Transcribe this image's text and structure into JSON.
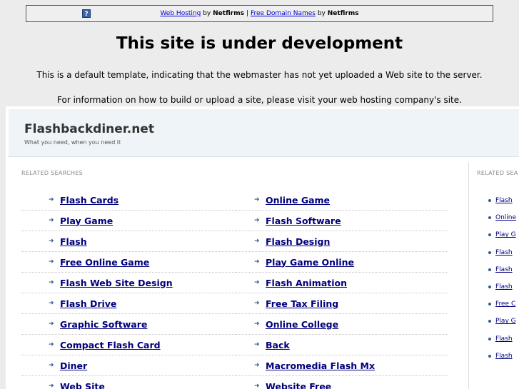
{
  "topbar": {
    "icon": "question-icon",
    "link1": "Web Hosting",
    "by1": "by",
    "brand1": "Netfirms",
    "sep": "|",
    "link2": "Free Domain Names",
    "by2": "by",
    "brand2": "Netfirms"
  },
  "title": "This site is under development",
  "info1": "This is a default template, indicating that the webmaster has not yet uploaded a Web site to the server.",
  "info2": "For information on how to build or upload a site, please visit your web hosting company's site.",
  "panel": {
    "site_name": "Flashbackdiner.net",
    "tagline": "What you need, when you need it",
    "related_label": "RELATED SEARCHES",
    "related_label_side": "RELATED SEA",
    "left_items": [
      "Flash Cards",
      "Play Game",
      "Flash",
      "Free Online Game",
      "Flash Web Site Design",
      "Flash Drive",
      "Graphic Software",
      "Compact Flash Card",
      "Diner",
      "Web Site"
    ],
    "right_items": [
      "Online Game",
      "Flash Software",
      "Flash Design",
      "Play Game Online",
      "Flash Animation",
      "Free Tax Filing",
      "Online College",
      "Back",
      "Macromedia Flash Mx",
      "Website Free"
    ],
    "side_items": [
      "Flash",
      "Online",
      "Play G",
      "Flash",
      "Flash",
      "Flash",
      "Free C",
      "Play G",
      "Flash",
      "Flash"
    ]
  }
}
